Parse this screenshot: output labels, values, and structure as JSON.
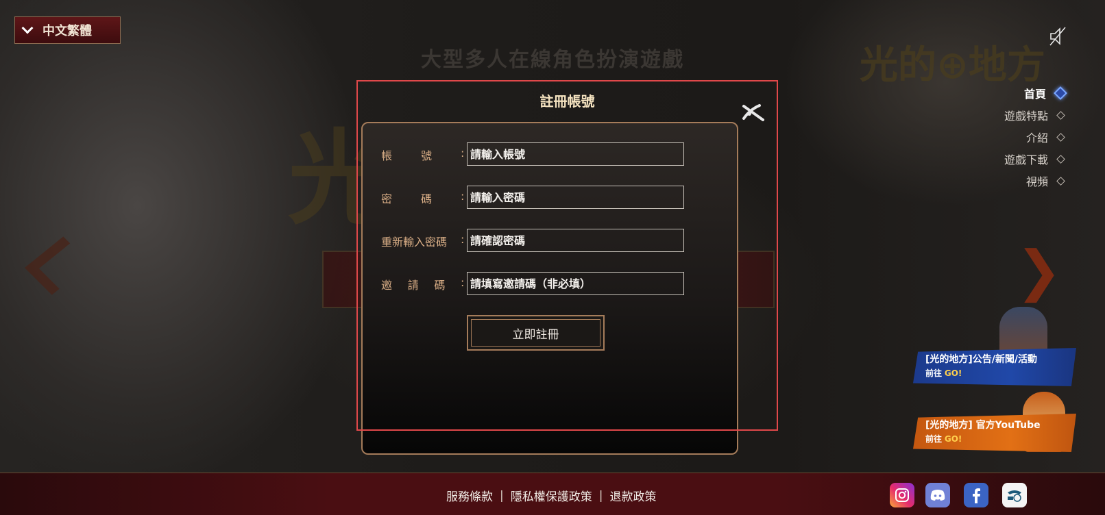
{
  "language_selector": {
    "label": "中文繁體"
  },
  "background": {
    "headline": "大型多人在線角色扮演遊戲",
    "logo_text": "光的地方",
    "logo_small": "光的⊕地方"
  },
  "side_nav": {
    "items": [
      {
        "label": "首頁",
        "active": true
      },
      {
        "label": "遊戲特點",
        "active": false
      },
      {
        "label": "介紹",
        "active": false
      },
      {
        "label": "遊戲下載",
        "active": false
      },
      {
        "label": "視頻",
        "active": false
      }
    ]
  },
  "promos": [
    {
      "title": "[光的地方]公告/新聞/活動",
      "sub_prefix": "前往",
      "sub_go": "GO!"
    },
    {
      "title": "[光的地方] 官方YouTube",
      "sub_prefix": "前往",
      "sub_go": "GO!"
    }
  ],
  "modal": {
    "title": "註冊帳號",
    "fields": [
      {
        "label": "帳號",
        "label_chars": [
          "帳",
          "號"
        ],
        "placeholder": "請輸入帳號"
      },
      {
        "label": "密碼",
        "label_chars": [
          "密",
          "碼"
        ],
        "placeholder": "請輸入密碼"
      },
      {
        "label": "重新輸入密碼",
        "label_chars": [
          "重新輸入密碼"
        ],
        "placeholder": "請確認密碼"
      },
      {
        "label": "邀請碼",
        "label_chars": [
          "邀",
          "請",
          "碼"
        ],
        "placeholder": "請填寫邀請碼（非必填）"
      }
    ],
    "submit_label": "立即註冊"
  },
  "footer": {
    "links": [
      "服務條款",
      "隱私權保護政策",
      "退款政策"
    ],
    "separator": "|"
  },
  "social_icons": [
    "instagram-icon",
    "discord-icon",
    "facebook-icon",
    "partner-logo-icon"
  ],
  "colors": {
    "accent_gold": "#d9ae86",
    "modal_border": "#a57c5a",
    "outline_red": "#e0484a",
    "footer_red": "#4a0e12"
  }
}
